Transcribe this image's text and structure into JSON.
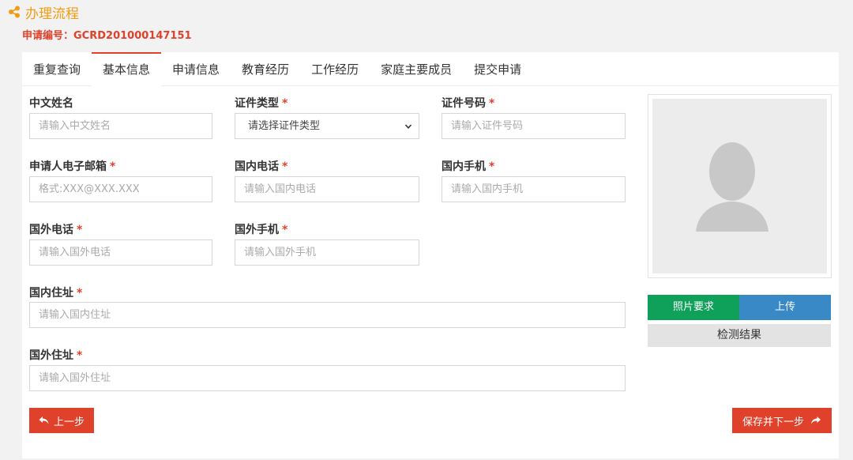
{
  "header": {
    "title": "办理流程",
    "app_no_label": "申请编号：",
    "app_no_value": "GCRD201000147151"
  },
  "tabs": [
    {
      "label": "重复查询",
      "active": false
    },
    {
      "label": "基本信息",
      "active": true
    },
    {
      "label": "申请信息",
      "active": false
    },
    {
      "label": "教育经历",
      "active": false
    },
    {
      "label": "工作经历",
      "active": false
    },
    {
      "label": "家庭主要成员",
      "active": false
    },
    {
      "label": "提交申请",
      "active": false
    }
  ],
  "form": {
    "chinese_name": {
      "label": "中文姓名",
      "required": false,
      "placeholder": "请输入中文姓名"
    },
    "id_type": {
      "label": "证件类型",
      "required": true,
      "selected": "请选择证件类型"
    },
    "id_number": {
      "label": "证件号码",
      "required": true,
      "placeholder": "请输入证件号码"
    },
    "email": {
      "label": "申请人电子邮箱",
      "required": true,
      "placeholder": "格式:XXX@XXX.XXX"
    },
    "domestic_phone": {
      "label": "国内电话",
      "required": true,
      "placeholder": "请输入国内电话"
    },
    "domestic_mobile": {
      "label": "国内手机",
      "required": true,
      "placeholder": "请输入国内手机"
    },
    "foreign_phone": {
      "label": "国外电话",
      "required": true,
      "placeholder": "请输入国外电话"
    },
    "foreign_mobile": {
      "label": "国外手机",
      "required": true,
      "placeholder": "请输入国外手机"
    },
    "domestic_address": {
      "label": "国内住址",
      "required": true,
      "placeholder": "请输入国内住址"
    },
    "foreign_address": {
      "label": "国外住址",
      "required": true,
      "placeholder": "请输入国外住址"
    },
    "required_mark": "*"
  },
  "photo": {
    "requirements_label": "照片要求",
    "upload_label": "上传",
    "detect_label": "检测结果"
  },
  "nav": {
    "prev_label": "上一步",
    "next_label": "保存并下一步"
  },
  "colors": {
    "accent": "#e0412a",
    "title_orange": "#f39c12",
    "green": "#0fa15a",
    "blue": "#3989c6"
  },
  "icons": {
    "title": "share-icon",
    "prev": "reply-icon",
    "next": "forward-icon",
    "select": "chevron-down-icon",
    "avatar": "user-silhouette-icon"
  }
}
